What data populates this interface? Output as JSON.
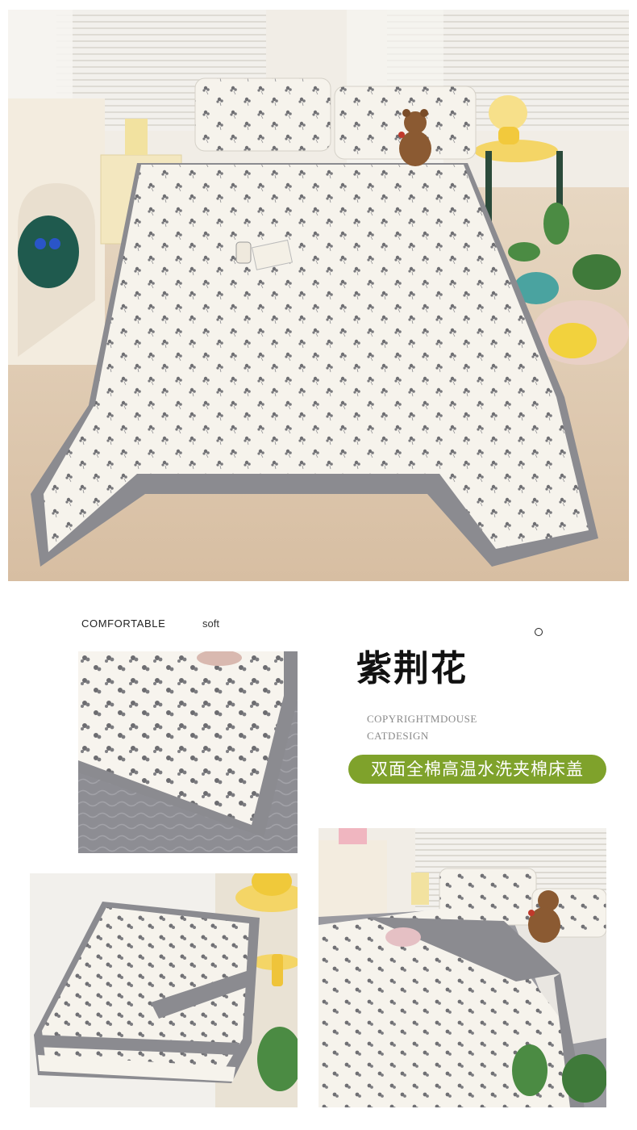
{
  "header": {
    "tag_left": "COMFORTABLE",
    "tag_right": "soft"
  },
  "product": {
    "title": "紫荆花",
    "copyright_line1": "COPYRIGHTMDOUSE",
    "copyright_line2": "CATDESIGN",
    "subtitle_pill": "双面全棉高温水洗夹棉床盖"
  },
  "colors": {
    "accent_green": "#7fa22b",
    "border_gray": "#8b8b90",
    "fabric_cream": "#f5f2ea",
    "flower_gray": "#6f6f72",
    "floor_wood": "#dcc6ab"
  },
  "images": {
    "hero": "bedroom-bedspread-photo",
    "detail": "quilted-edge-closeup-photo",
    "folded": "folded-bedspread-photo",
    "bed_corner": "bed-with-teddy-bear-photo"
  }
}
